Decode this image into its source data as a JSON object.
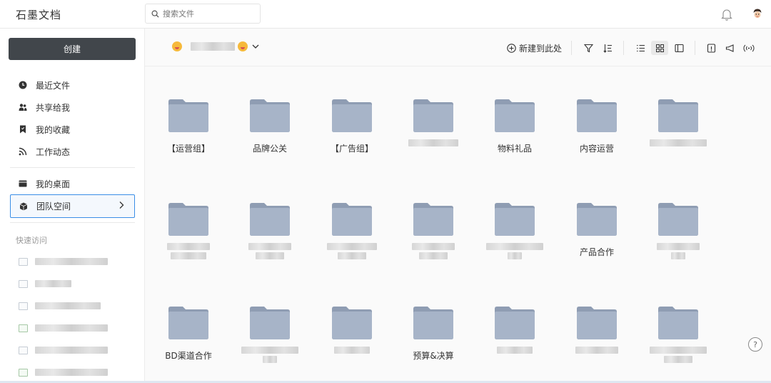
{
  "app": {
    "title": "石墨文档"
  },
  "search": {
    "placeholder": "搜索文件"
  },
  "sidebar": {
    "create_label": "创建",
    "items": [
      {
        "label": "最近文件",
        "icon": "clock-icon"
      },
      {
        "label": "共享给我",
        "icon": "users-icon"
      },
      {
        "label": "我的收藏",
        "icon": "bookmark-icon"
      },
      {
        "label": "工作动态",
        "icon": "rss-icon"
      }
    ],
    "items2": [
      {
        "label": "我的桌面",
        "icon": "desktop-icon"
      },
      {
        "label": "团队空间",
        "icon": "cube-icon",
        "active": true
      }
    ],
    "quick_access_label": "快速访问"
  },
  "toolbar": {
    "new_here_label": "新建到此处"
  },
  "folders": [
    {
      "label": "【运营组】"
    },
    {
      "label": "品牌公关"
    },
    {
      "label": "【广告组】"
    },
    {
      "label": ""
    },
    {
      "label": "物料礼品"
    },
    {
      "label": "内容运营"
    },
    {
      "label": ""
    },
    {
      "label": ""
    },
    {
      "label": ""
    },
    {
      "label": ""
    },
    {
      "label": ""
    },
    {
      "label": ""
    },
    {
      "label": "产品合作"
    },
    {
      "label": ""
    },
    {
      "label": "BD渠道合作"
    },
    {
      "label": ""
    },
    {
      "label": ""
    },
    {
      "label": "预算&决算"
    },
    {
      "label": ""
    },
    {
      "label": ""
    },
    {
      "label": ""
    }
  ],
  "help_label": "?",
  "colors": {
    "accent": "#3a8ee6",
    "create_button": "#41464b",
    "folder": "#a3b1c6"
  }
}
